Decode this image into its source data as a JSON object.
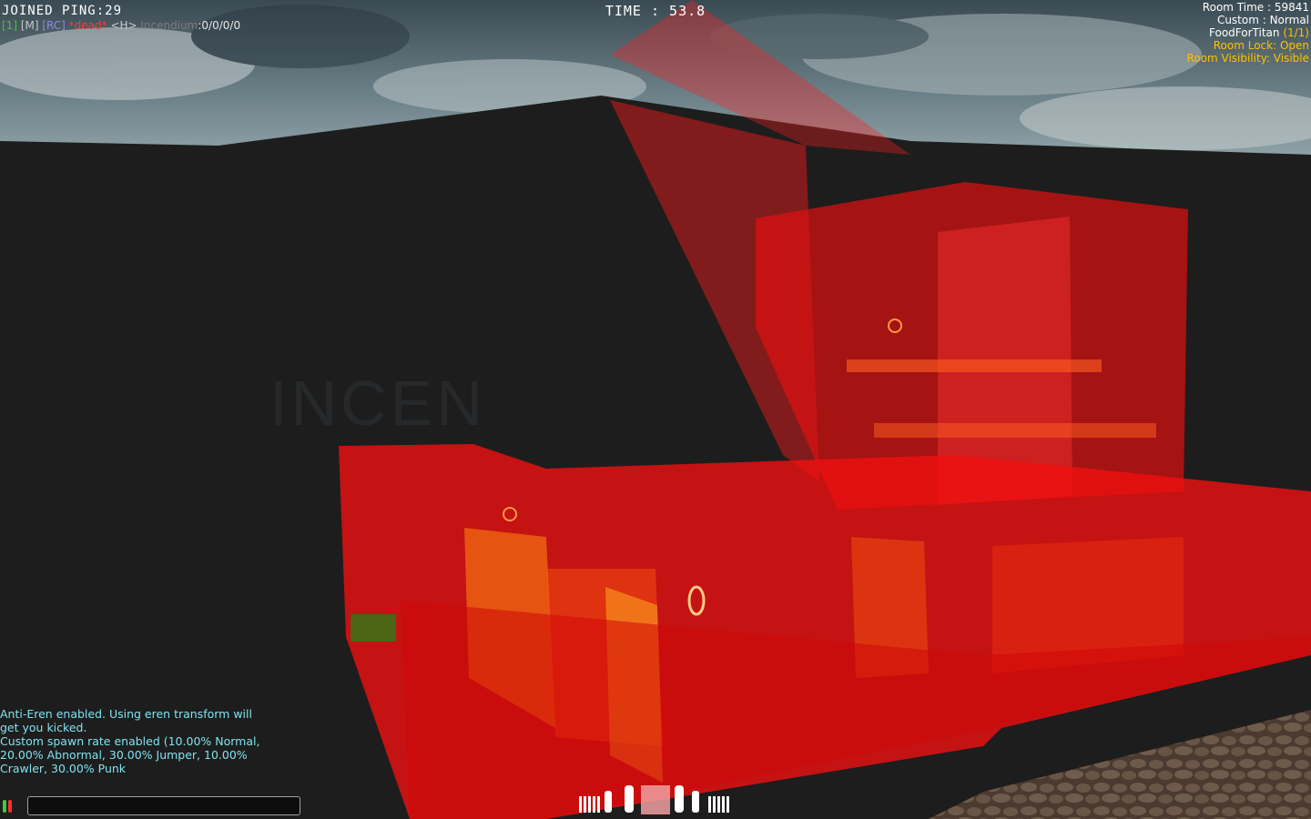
{
  "hud": {
    "joined_ping": "JOINED PING:29",
    "player_tags": [
      {
        "text": "[1]",
        "color": "#3cc83c"
      },
      {
        "text": " [M]",
        "color": "#c8c8c8"
      },
      {
        "text": " [RC]",
        "color": "#8c8cdc"
      },
      {
        "text": " *dead*",
        "color": "#ff3a3a"
      },
      {
        "text": " <H>",
        "color": "#c8c8c8"
      },
      {
        "text": " Incendium",
        "color": "#7a7a7a"
      },
      {
        "text": ":0/0/0/0",
        "color": "#e6e6e6"
      }
    ],
    "timer": "TIME : 53.8"
  },
  "room_info": {
    "room_time": "Room Time : 59841",
    "mode": "Custom : Normal",
    "room_name": "FoodForTitan",
    "player_count": "(1/1)",
    "room_lock": "Room Lock: Open",
    "room_visibility": "Room Visibility: Visible",
    "white_color": "#ffffff",
    "yellow_color": "#ffc000"
  },
  "chat": {
    "messages": [
      "Anti-Eren enabled. Using eren transform will get you kicked.",
      "Custom spawn rate enabled (10.00% Normal, 20.00% Abnormal, 30.00% Jumper, 10.00% Crawler, 30.00% Punk"
    ],
    "text_color": "#7fe3f0"
  },
  "map_sign": "INCEN",
  "chat_input": {
    "value": ""
  },
  "gas_indicator": {
    "left_color": "#3ccc3c",
    "right_color": "#ff3030"
  },
  "blades": {
    "left_blades": 5,
    "right_blades": 5
  }
}
